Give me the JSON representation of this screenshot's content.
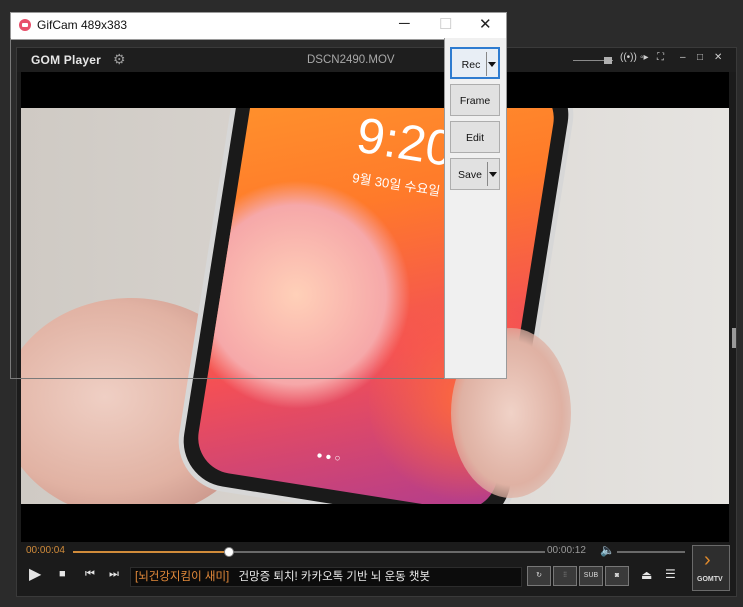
{
  "gom": {
    "logo": "GOM Player",
    "filename": "DSCN2490.MOV",
    "titlebar_buttons": {
      "minimize": "–",
      "maximize": "□",
      "close": "✕"
    },
    "video": {
      "clock": "9:20",
      "date": "9월 30일 수요일"
    },
    "time_current": "00:00:04",
    "time_total": "00:00:12",
    "seek_progress": 0.33,
    "subtitle": {
      "tag": "[뇌건강지킴이 새미]",
      "text": "건망증 퇴치! 카카오톡 기반 뇌 운동 챗봇"
    },
    "buttons": {
      "sub": "SUB",
      "gomtv": "GOMTV"
    }
  },
  "gifcam": {
    "title": "GifCam 489x383",
    "buttons": {
      "rec": "Rec",
      "frame": "Frame",
      "edit": "Edit",
      "save": "Save"
    }
  }
}
